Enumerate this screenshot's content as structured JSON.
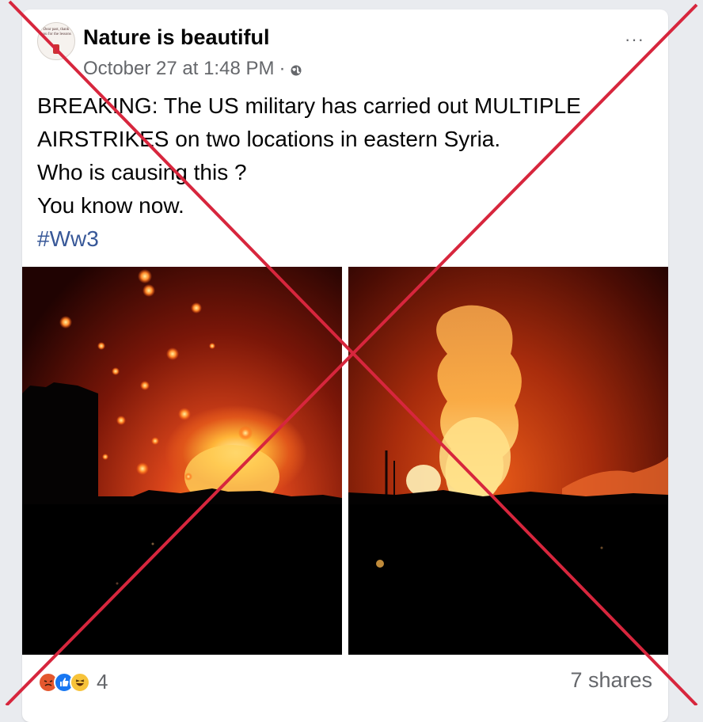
{
  "post": {
    "page_name": "Nature is beautiful",
    "timestamp": "October 27 at 1:48 PM",
    "separator": "·",
    "privacy_icon": "globe-icon",
    "more_label": "···",
    "avatar_text": "Dear past, thank you for the lessons",
    "lines": [
      "BREAKING: The US military has carried out MULTIPLE",
      "AIRSTRIKES on two locations in eastern Syria.",
      "Who is causing this ?",
      "You know now."
    ],
    "hashtag": "#Ww3"
  },
  "photos": [
    {
      "name": "night-explosion-photo-left"
    },
    {
      "name": "night-explosion-photo-right"
    }
  ],
  "footer": {
    "reaction_icons": [
      "angry-icon",
      "like-icon",
      "haha-icon"
    ],
    "reaction_count": "4",
    "shares": "7 shares"
  },
  "overlay": {
    "type": "red-cross",
    "color": "#d7263d"
  }
}
